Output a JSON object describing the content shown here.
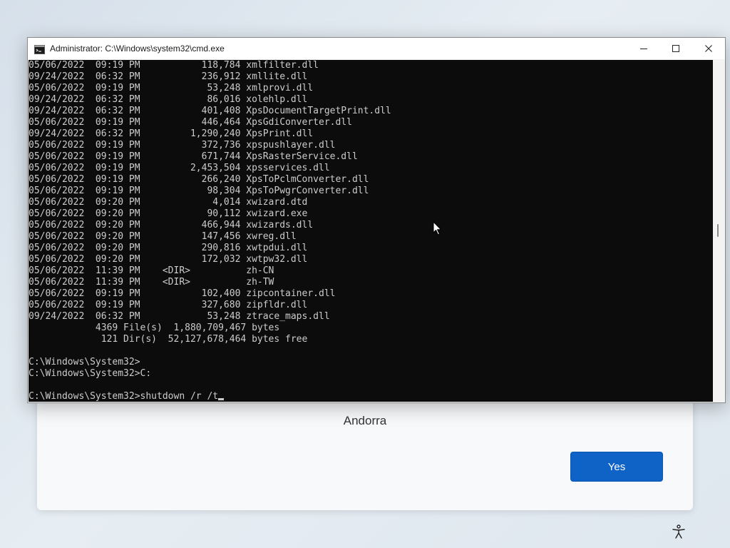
{
  "background": {
    "region_name": "Andorra",
    "yes_button_label": "Yes",
    "accessibility_icon": "accessibility-icon",
    "accent_color": "#0f62c6"
  },
  "window": {
    "title": "Administrator: C:\\Windows\\system32\\cmd.exe",
    "app_icon": "cmd-icon",
    "controls": {
      "minimize": "minimize-icon",
      "maximize": "maximize-icon",
      "close": "close-icon"
    }
  },
  "console": {
    "lines": [
      "05/06/2022  09:19 PM           118,784 xmlfilter.dll",
      "09/24/2022  06:32 PM           236,912 xmllite.dll",
      "05/06/2022  09:19 PM            53,248 xmlprovi.dll",
      "09/24/2022  06:32 PM            86,016 xolehlp.dll",
      "09/24/2022  06:32 PM           401,408 XpsDocumentTargetPrint.dll",
      "05/06/2022  09:19 PM           446,464 XpsGdiConverter.dll",
      "09/24/2022  06:32 PM         1,290,240 XpsPrint.dll",
      "05/06/2022  09:19 PM           372,736 xpspushlayer.dll",
      "05/06/2022  09:19 PM           671,744 XpsRasterService.dll",
      "05/06/2022  09:19 PM         2,453,504 xpsservices.dll",
      "05/06/2022  09:19 PM           266,240 XpsToPclmConverter.dll",
      "05/06/2022  09:19 PM            98,304 XpsToPwgrConverter.dll",
      "05/06/2022  09:20 PM             4,014 xwizard.dtd",
      "05/06/2022  09:20 PM            90,112 xwizard.exe",
      "05/06/2022  09:20 PM           466,944 xwizards.dll",
      "05/06/2022  09:20 PM           147,456 xwreg.dll",
      "05/06/2022  09:20 PM           290,816 xwtpdui.dll",
      "05/06/2022  09:20 PM           172,032 xwtpw32.dll",
      "05/06/2022  11:39 PM    <DIR>          zh-CN",
      "05/06/2022  11:39 PM    <DIR>          zh-TW",
      "05/06/2022  09:19 PM           102,400 zipcontainer.dll",
      "05/06/2022  09:19 PM           327,680 zipfldr.dll",
      "09/24/2022  06:32 PM            53,248 ztrace_maps.dll",
      "            4369 File(s)  1,880,709,467 bytes",
      "             121 Dir(s)  52,127,678,464 bytes free",
      "",
      "C:\\Windows\\System32>",
      "C:\\Windows\\System32>C:",
      ""
    ],
    "prompt_line": "C:\\Windows\\System32>shutdown /r /t",
    "text_color": "#cccccc",
    "background_color": "#0c0c0c"
  }
}
